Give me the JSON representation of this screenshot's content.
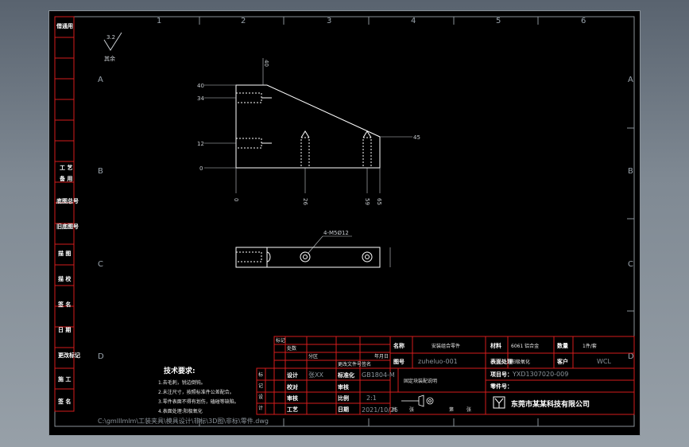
{
  "border": {
    "columns": [
      "1",
      "2",
      "3",
      "4",
      "5",
      "6"
    ],
    "rows": [
      "A",
      "B",
      "C",
      "D"
    ]
  },
  "left_strip": {
    "items": [
      "借(通)用件登记",
      "工艺",
      "描图",
      "描校",
      "底图总号",
      "签字",
      "日期",
      "旧底图总号",
      "更改标记",
      "标记",
      "处数",
      "更改文件号"
    ],
    "top_label": "借通用",
    "mid_labels": [
      "工 艺",
      "备 用",
      "底图总号",
      "旧底图号",
      "描 图",
      "描 校",
      "签 名",
      "日 期",
      "更改标记",
      "施 工",
      "签 名",
      "旧底图"
    ]
  },
  "drawing": {
    "roughness": "3.2",
    "roughness_note": "其余",
    "dims_left": [
      "40",
      "34",
      "12",
      "0"
    ],
    "dims_top": "40",
    "dims_bottom": [
      "0",
      "26",
      "59",
      "65"
    ],
    "dim_right": "45",
    "hole_note": "4-M5Ø12"
  },
  "tech_req": {
    "title": "技术要求:",
    "lines": [
      "1.去毛刺，锐边倒钝。",
      "2.未注尺寸，按照标准件公差配合。",
      "3.零件表面不得有划伤，磕碰等缺陷。",
      "4.表面处理:阳极氧化"
    ]
  },
  "path_text": "C:\\gmlllmlm\\工装夹具\\模具设计\\非标\\3D图\\非标\\零件.dwg",
  "title_block": {
    "label_name": "名称",
    "name": "安装组合零件",
    "label_material": "材料",
    "material": "6061 铝合金",
    "label_qty": "数量",
    "qty": "1件/套",
    "label_drawno": "图号",
    "drawno": "zuheluo-001",
    "label_surface": "表面处理",
    "surface": "阳极氧化",
    "label_customer": "客户",
    "customer": "WCL",
    "label_projno": "项目号：",
    "projno": "YXD1307020-009",
    "label_partno": "零件号：",
    "partno": "",
    "part_title": "固定块装配说明",
    "company": "东莞市某某科技有限公司",
    "rows": [
      {
        "a": "设计",
        "b": "张XX",
        "c": "标准化",
        "d": "GB1804-M"
      },
      {
        "a": "校对",
        "b": "",
        "c": "审核",
        "d": ""
      },
      {
        "a": "审核",
        "b": "",
        "c": "比例",
        "d": "2:1"
      },
      {
        "a": "工艺",
        "b": "",
        "c": "日期",
        "d": "2021/10/25"
      }
    ],
    "header_cols": [
      "标记",
      "处数",
      "分区",
      "更改文件号",
      "签名",
      "年月日"
    ],
    "side_labels": [
      "标",
      "记",
      "设",
      "计"
    ],
    "sheet_info": [
      "共",
      "张",
      "第",
      "张"
    ]
  },
  "colors": {
    "frame_red": "#d41c1c",
    "line_white": "#ffffff",
    "bg_black": "#000000"
  }
}
